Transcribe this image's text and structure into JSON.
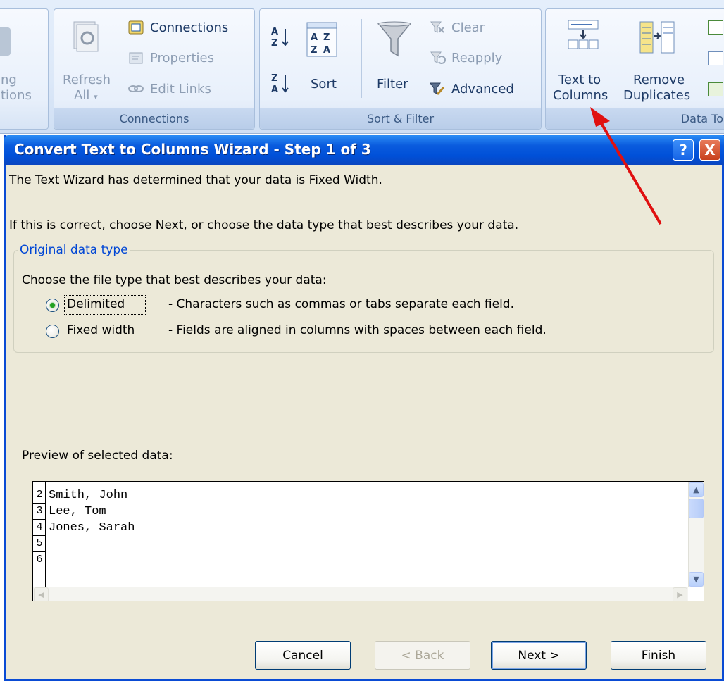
{
  "ribbon": {
    "partial_group": {
      "label_line1": "ng",
      "label_line2": "tions"
    },
    "connections_group": {
      "label": "Connections",
      "refresh_line1": "Refresh",
      "refresh_line2": "All",
      "connections": "Connections",
      "properties": "Properties",
      "edit_links": "Edit Links"
    },
    "sort_filter_group": {
      "label": "Sort & Filter",
      "sort": "Sort",
      "filter": "Filter",
      "clear": "Clear",
      "reapply": "Reapply",
      "advanced": "Advanced"
    },
    "data_tools_group": {
      "label": "Data To",
      "text_to_columns_line1": "Text to",
      "text_to_columns_line2": "Columns",
      "remove_duplicates_line1": "Remove",
      "remove_duplicates_line2": "Duplicates"
    }
  },
  "dialog": {
    "title": "Convert Text to Columns Wizard - Step 1 of 3",
    "help_glyph": "?",
    "close_glyph": "X",
    "line1": "The Text Wizard has determined that your data is Fixed Width.",
    "line2": "If this is correct, choose Next, or choose the data type that best describes your data.",
    "fieldset_legend": "Original data type",
    "choose_prompt": "Choose the file type that best describes your data:",
    "options": [
      {
        "label": "Delimited",
        "desc": "- Characters such as commas or tabs separate each field.",
        "checked": true
      },
      {
        "label": "Fixed width",
        "desc": "- Fields are aligned in columns with spaces between each field.",
        "checked": false
      }
    ],
    "preview_label": "Preview of selected data:",
    "preview_rows": [
      {
        "num": "2",
        "text": "Smith, John"
      },
      {
        "num": "3",
        "text": "Lee, Tom"
      },
      {
        "num": "4",
        "text": "Jones, Sarah"
      },
      {
        "num": "5",
        "text": ""
      },
      {
        "num": "6",
        "text": ""
      }
    ],
    "buttons": {
      "cancel": "Cancel",
      "back": "< Back",
      "next": "Next >",
      "finish": "Finish"
    }
  },
  "colors": {
    "title_blue": "#0050d8",
    "annotation_arrow": "#e01010",
    "legend_blue": "#0046d5"
  }
}
